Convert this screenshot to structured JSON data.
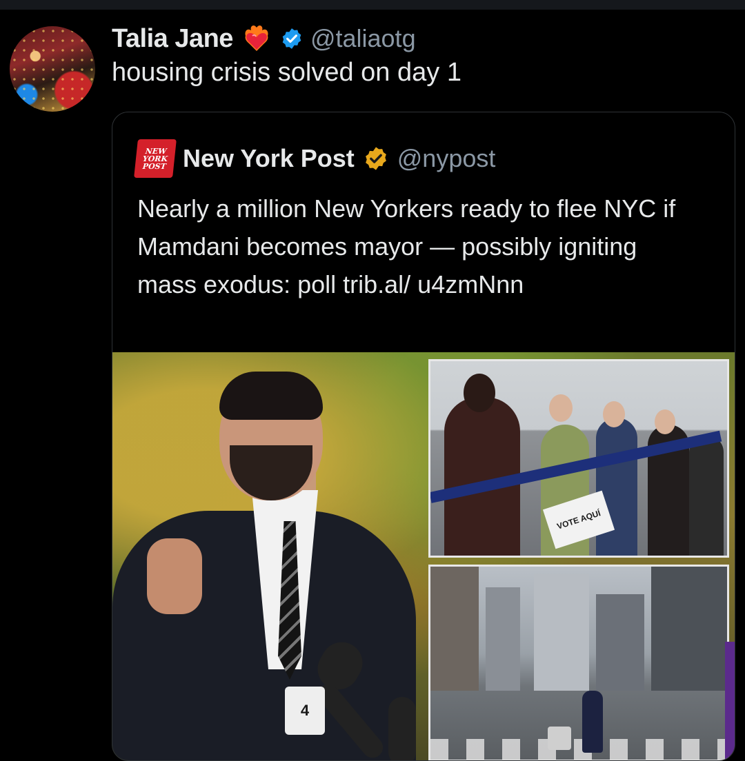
{
  "tweet": {
    "author_name": "Talia Jane",
    "author_handle": "@taliaotg",
    "text": "housing crisis solved on day 1"
  },
  "quoted_tweet": {
    "logo_text": [
      "NEW",
      "YORK",
      "POST"
    ],
    "author_name": "New York Post",
    "author_handle": "@nypost",
    "text": "Nearly a million New Yorkers ready to flee NYC if Mamdani becomes mayor — possibly igniting mass exodus: poll trib.al/ u4zmNnn"
  },
  "media": {
    "mic_flag_text": "4",
    "vote_sign_text": "VOTE AQUÍ"
  },
  "colors": {
    "background": "#000000",
    "text_primary": "#e7e9ea",
    "text_secondary": "#8b98a5",
    "verified_blue": "#1d9bf0",
    "verified_gold": "#e8a81c",
    "nypost_red": "#d4202a"
  },
  "icons": {
    "emoji": "heart-on-fire-icon",
    "verified": "verified-badge-icon",
    "gold_verified": "gold-verified-badge-icon"
  }
}
